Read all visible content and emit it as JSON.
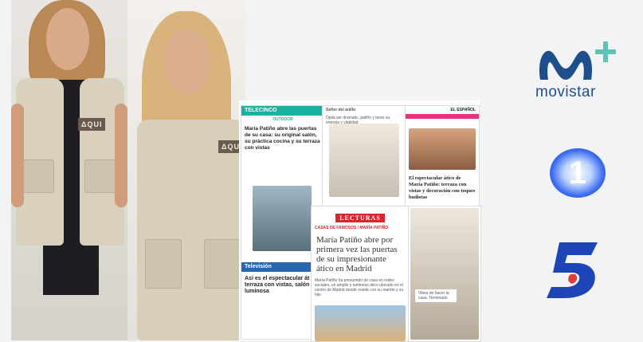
{
  "brand_badge": "ΔQUI",
  "collage": {
    "telecinco_card": {
      "channel": "TELECINCO",
      "section": "OUTDOOR",
      "title": "María Patiño abre las puertas de su casa: su original salón, su práctica cocina y su terraza con vistas",
      "bottom_section": "Televisión",
      "bottom_title": "Así es el espectacular át terraza con vistas, salón luminosa"
    },
    "tweet_card": {
      "author": "Señor del anillo",
      "text": "Ojalá ser dramatic, patiño y tener su energía y vitalidad"
    },
    "elespanol_card": {
      "logo": "EL ESPAÑOL",
      "title": "El espectacular ático de María Patiño: terraza con vistas y decoración con toques budistas"
    },
    "lecturas_card": {
      "logo": "LECTURAS",
      "category": "CASAS DE FAMOSOS / MARÍA PATIÑO",
      "title": "María Patiño abre por primera vez las puertas de su impresionante ático en Madrid",
      "body": "María Patiño ha presumido de casa en redes sociales, un amplio y luminoso ático ubicado en el centro de Madrid donde reside con su marido y su hijo"
    },
    "story_card": {
      "caption": "Vibes de hacer la casa. Terminado"
    }
  },
  "logos": {
    "movistar": "movistar",
    "la1": "1"
  },
  "colors": {
    "movistar_blue": "#1d4f8c",
    "movistar_green": "#5fc2b4",
    "la1_blue": "#2a4fd9",
    "telecinco_teal": "#18b3a0",
    "lecturas_red": "#d6252b",
    "elespanol_pink": "#e8317d"
  }
}
